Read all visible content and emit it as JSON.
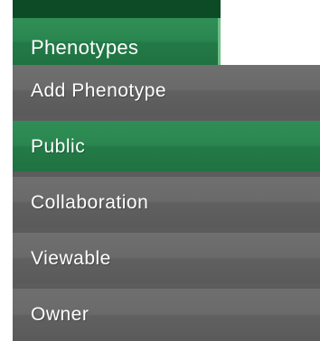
{
  "menu": {
    "tab_label": "Phenotypes",
    "items": [
      {
        "label": "Add Phenotype",
        "active": false
      },
      {
        "label": "Public",
        "active": true
      },
      {
        "label": "Collaboration",
        "active": false
      },
      {
        "label": "Viewable",
        "active": false
      },
      {
        "label": "Owner",
        "active": false
      }
    ]
  },
  "colors": {
    "accent_green": "#2a8650",
    "dark_green": "#0d4a26",
    "menu_gray": "#6a6a6a",
    "text": "#ffffff"
  }
}
